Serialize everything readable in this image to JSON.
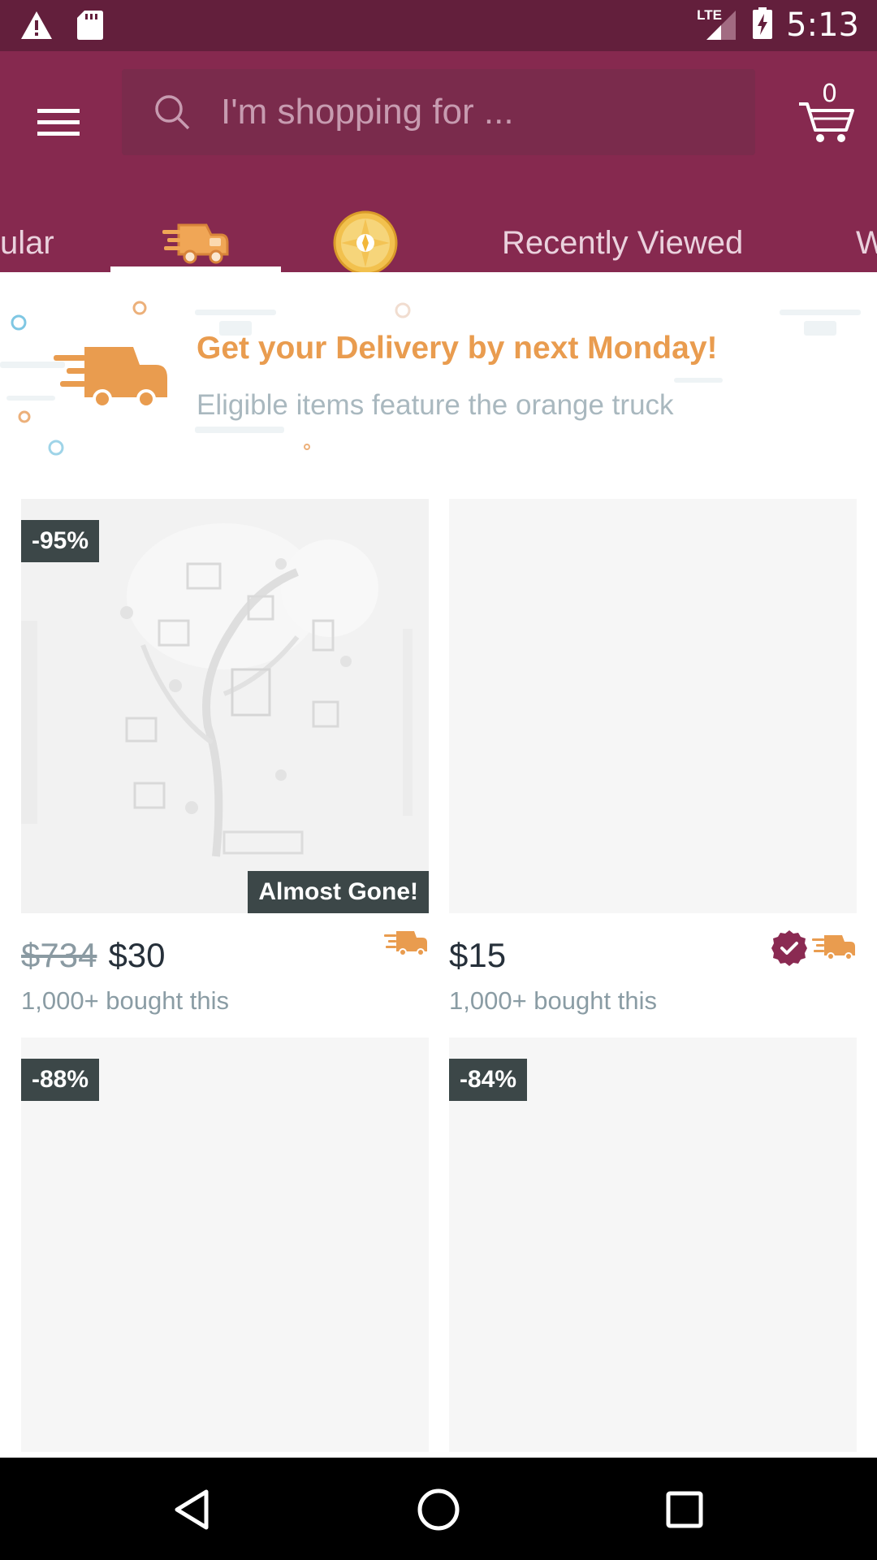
{
  "status_bar": {
    "time": "5:13",
    "network": "LTE",
    "icons": [
      "warning-icon",
      "sd-card-icon",
      "signal-icon",
      "battery-charging-icon"
    ]
  },
  "app_bar": {
    "search": {
      "placeholder": "I'm shopping for ...",
      "value": ""
    },
    "cart": {
      "count": "0"
    },
    "icons": [
      "menu-icon",
      "search-icon",
      "cart-icon"
    ]
  },
  "tabs": [
    {
      "label": "ular",
      "type": "text"
    },
    {
      "label": "",
      "type": "icon",
      "icon": "delivery-truck-icon",
      "selected": true
    },
    {
      "label": "",
      "type": "icon",
      "icon": "blitz-buy-icon"
    },
    {
      "label": "Recently Viewed",
      "type": "text"
    },
    {
      "label": "W",
      "type": "text"
    }
  ],
  "banner": {
    "title": "Get your Delivery by next Monday!",
    "subtitle": "Eligible items feature the orange truck",
    "icon": "delivery-truck-icon"
  },
  "products": [
    {
      "discount": "-95%",
      "tag": "Almost Gone!",
      "old_price": "$734",
      "price": "$30",
      "bought": "1,000+ bought this",
      "badges": [
        "delivery-truck-icon"
      ]
    },
    {
      "discount": "",
      "tag": "",
      "old_price": "",
      "price": "$15",
      "bought": "1,000+ bought this",
      "badges": [
        "verified-badge-icon",
        "delivery-truck-icon"
      ]
    },
    {
      "discount": "-88%",
      "tag": "",
      "old_price": "",
      "price": "",
      "bought": "",
      "badges": []
    },
    {
      "discount": "-84%",
      "tag": "",
      "old_price": "",
      "price": "",
      "bought": "",
      "badges": []
    }
  ],
  "colors": {
    "status_bar": "#631f3c",
    "app_bar": "#86294f",
    "accent_orange": "#e99c4f",
    "badge_dark": "#3c4748",
    "verified": "#8a2a52"
  },
  "nav_bar": {
    "icons": [
      "back-icon",
      "home-icon",
      "recents-icon"
    ]
  }
}
